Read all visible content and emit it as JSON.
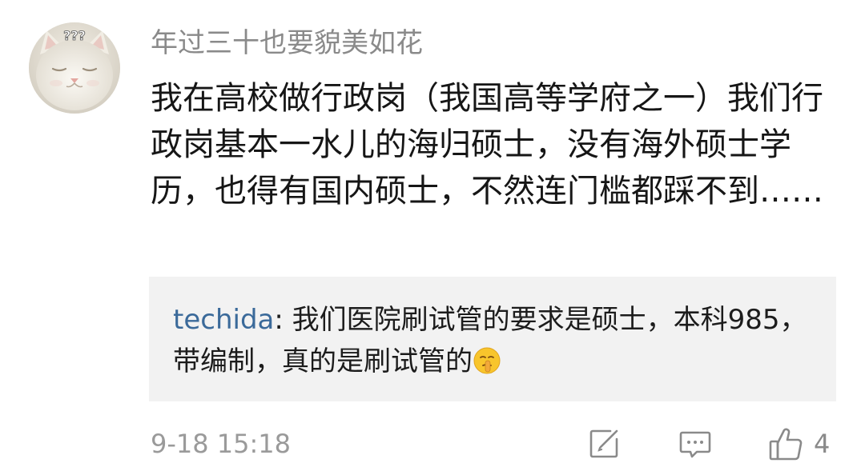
{
  "comment": {
    "username": "年过三十也要貌美如花",
    "avatar_icon": "white-cat-avatar-icon",
    "avatar_marks": "???",
    "body": "我在高校做行政岗（我国高等学府之一）我们行政岗基本一水儿的海归硕士，没有海外硕士学历，也得有国内硕士，不然连门槛都踩不到……"
  },
  "reply": {
    "user": "techida",
    "separator": ": ",
    "text": "我们医院刷试管的要求是硕士，本科985，带编制，真的是刷试管的",
    "emoji_icon": "shush-face-emoji-icon"
  },
  "footer": {
    "timestamp": "9-18 15:18",
    "share_icon": "edit-share-icon",
    "comment_icon": "comment-bubble-icon",
    "like_icon": "thumbs-up-icon",
    "like_count": "4"
  },
  "colors": {
    "username": "#8a8a8a",
    "reply_user": "#3b6a9a",
    "reply_bg": "#f2f2f2",
    "footer": "#9a9a9a"
  }
}
